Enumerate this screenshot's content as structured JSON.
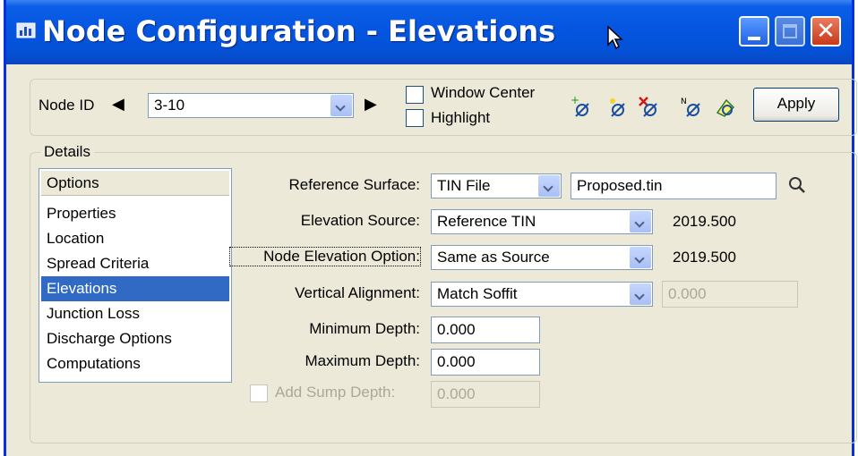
{
  "window": {
    "title": "Node Configuration - Elevations",
    "app_icon": "bar-chart-icon",
    "controls": [
      "minimize-icon",
      "maximize-icon",
      "close-icon"
    ]
  },
  "toolbar": {
    "node_id_label": "Node ID",
    "node_id_value": "3-10",
    "window_center_label": "Window Center",
    "highlight_label": "Highlight",
    "window_center_checked": false,
    "highlight_checked": false,
    "tools": [
      "add-node-icon",
      "select-node-icon",
      "delete-node-icon",
      "rename-node-icon",
      "highlight-node-icon"
    ],
    "apply_label": "Apply"
  },
  "details": {
    "legend": "Details",
    "options_header": "Options",
    "options": [
      "Properties",
      "Location",
      "Spread Criteria",
      "Elevations",
      "Junction Loss",
      "Discharge Options",
      "Computations"
    ],
    "selected_option": "Elevations"
  },
  "form": {
    "reference_surface_label": "Reference Surface:",
    "reference_surface_type": "TIN File",
    "reference_surface_file": "Proposed.tin",
    "elevation_source_label": "Elevation Source:",
    "elevation_source_value": "Reference TIN",
    "elevation_source_result": "2019.500",
    "node_elevation_option_label": "Node Elevation Option:",
    "node_elevation_option_value": "Same as Source",
    "node_elevation_option_result": "2019.500",
    "vertical_alignment_label": "Vertical Alignment:",
    "vertical_alignment_value": "Match Soffit",
    "vertical_alignment_offset": "0.000",
    "minimum_depth_label": "Minimum Depth:",
    "minimum_depth_value": "0.000",
    "maximum_depth_label": "Maximum Depth:",
    "maximum_depth_value": "0.000",
    "add_sump_depth_label": "Add Sump Depth:",
    "add_sump_depth_checked": false,
    "add_sump_depth_value": "0.000"
  },
  "colors": {
    "titlebar": "#0555e0",
    "selection": "#316ac5",
    "dialog_bg": "#ece9d8"
  }
}
